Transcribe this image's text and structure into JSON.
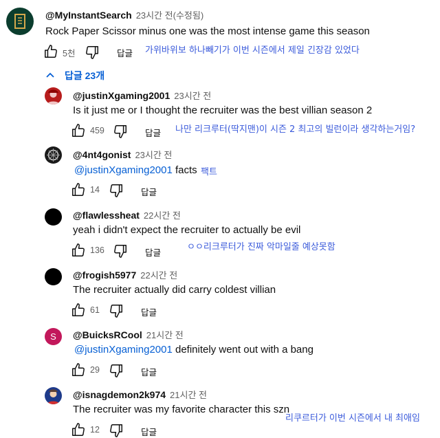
{
  "top_comment": {
    "handle": "@MyInstantSearch",
    "time": "23시간 전(수정됨)",
    "text": "Rock Paper Scissor minus one was the most intense game this season",
    "likes": "5천",
    "reply_label": "답글",
    "annotation": "가위바위보 하나빼기가 이번 시즌에서 제일 긴장감 있었다"
  },
  "replies_toggle": "답글 23개",
  "replies": [
    {
      "handle": "@justinXgaming2001",
      "time": "23시간 전",
      "mention": "",
      "text": "Is it just me or I thought the recruiter was the best villian season 2",
      "likes": "459",
      "reply_label": "답글",
      "annotation": "나만 리크루터(딱지맨)이 시즌 2 최고의 빌런이라 생각하는거임?"
    },
    {
      "handle": "@4nt4gonist",
      "time": "23시간 전",
      "mention": "@justinXgaming2001",
      "text": "facts",
      "likes": "14",
      "reply_label": "답글",
      "annotation": "팩트"
    },
    {
      "handle": "@flawlessheat",
      "time": "22시간 전",
      "mention": "",
      "text": "yeah i didn't expect the recruiter to actually be evil",
      "likes": "136",
      "reply_label": "답글",
      "annotation": "ㅇㅇ리크루터가 진짜 악마일줄 예상못함"
    },
    {
      "handle": "@frogish5977",
      "time": "22시간 전",
      "mention": "",
      "text": "The recruiter actually did carry coldest villian",
      "likes": "61",
      "reply_label": "답글",
      "annotation": ""
    },
    {
      "handle": "@BuicksRCool",
      "time": "21시간 전",
      "mention": "@justinXgaming2001",
      "text": "definitely went out with a bang",
      "likes": "29",
      "reply_label": "답글",
      "annotation": ""
    },
    {
      "handle": "@isnagdemon2k974",
      "time": "21시간 전",
      "mention": "",
      "text": "The recruiter was my favorite character this szn",
      "likes": "12",
      "reply_label": "답글",
      "annotation": "리쿠르터가 이번 시즌에서 내 최애임"
    }
  ],
  "avatar_letter_s": "S",
  "colors": {
    "accent": "#065fd4",
    "annotation": "#3b5bdb",
    "avatar_top": "#0b3d2e",
    "avatar_s": "#c2185b"
  }
}
